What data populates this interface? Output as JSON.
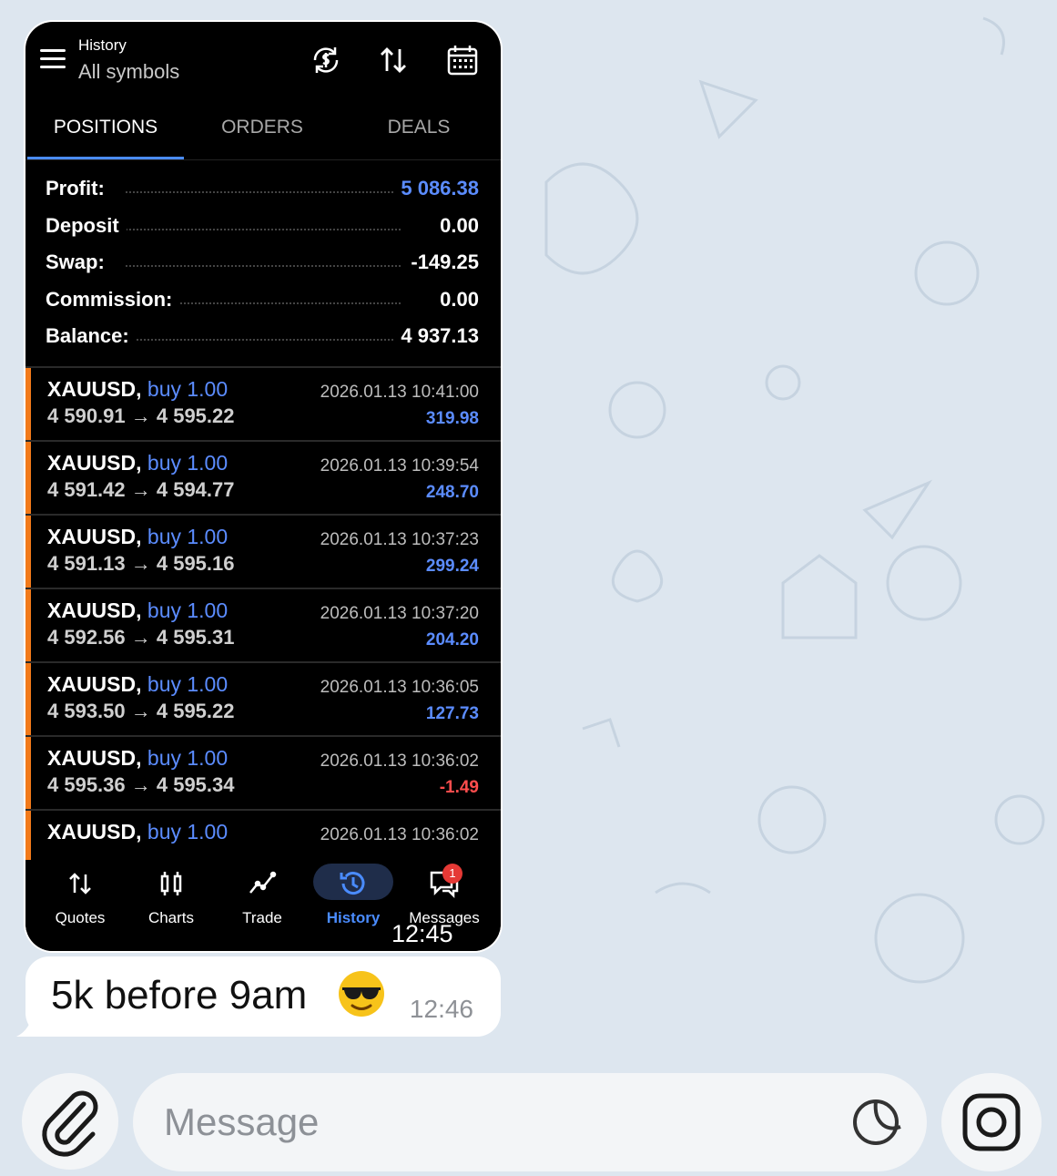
{
  "app": {
    "header_title": "History",
    "header_subtitle": "All symbols",
    "tabs": [
      "POSITIONS",
      "ORDERS",
      "DEALS"
    ],
    "active_tab": "POSITIONS"
  },
  "summary": [
    {
      "label": "Profit:",
      "value": "5 086.38",
      "highlight": true
    },
    {
      "label": "Deposit",
      "value": "0.00",
      "highlight": false
    },
    {
      "label": "Swap:",
      "value": "-149.25",
      "highlight": false
    },
    {
      "label": "Commission:",
      "value": "0.00",
      "highlight": false
    },
    {
      "label": "Balance:",
      "value": "4 937.13",
      "highlight": false
    }
  ],
  "deals": [
    {
      "symbol": "XAUUSD,",
      "direction": "buy 1.00",
      "prices": "4 590.91 → 4 595.22",
      "time": "2026.01.13 10:41:00",
      "pnl": "319.98",
      "negative": false
    },
    {
      "symbol": "XAUUSD,",
      "direction": "buy 1.00",
      "prices": "4 591.42 → 4 594.77",
      "time": "2026.01.13 10:39:54",
      "pnl": "248.70",
      "negative": false
    },
    {
      "symbol": "XAUUSD,",
      "direction": "buy 1.00",
      "prices": "4 591.13 → 4 595.16",
      "time": "2026.01.13 10:37:23",
      "pnl": "299.24",
      "negative": false
    },
    {
      "symbol": "XAUUSD,",
      "direction": "buy 1.00",
      "prices": "4 592.56 → 4 595.31",
      "time": "2026.01.13 10:37:20",
      "pnl": "204.20",
      "negative": false
    },
    {
      "symbol": "XAUUSD,",
      "direction": "buy 1.00",
      "prices": "4 593.50 → 4 595.22",
      "time": "2026.01.13 10:36:05",
      "pnl": "127.73",
      "negative": false
    },
    {
      "symbol": "XAUUSD,",
      "direction": "buy 1.00",
      "prices": "4 595.36 → 4 595.34",
      "time": "2026.01.13 10:36:02",
      "pnl": "-1.49",
      "negative": true
    },
    {
      "symbol": "XAUUSD,",
      "direction": "buy 1.00",
      "prices": "",
      "time": "2026.01.13 10:36:02",
      "pnl": "",
      "negative": false
    }
  ],
  "bottom_nav": [
    {
      "label": "Quotes",
      "icon": "quotes-icon"
    },
    {
      "label": "Charts",
      "icon": "charts-icon"
    },
    {
      "label": "Trade",
      "icon": "trade-icon"
    },
    {
      "label": "History",
      "icon": "history-icon",
      "active": true
    },
    {
      "label": "Messages",
      "icon": "messages-icon",
      "badge": "1"
    }
  ],
  "image_timestamp": "12:45",
  "message": {
    "text": "5k before 9am",
    "emoji": "smiling-face-with-sunglasses",
    "time": "12:46"
  },
  "composer": {
    "placeholder": "Message"
  },
  "colors": {
    "accent_blue": "#5b8cff",
    "negative_red": "#ff4d4d",
    "position_bar": "#f27a1a",
    "chat_background": "#dde6ef"
  }
}
